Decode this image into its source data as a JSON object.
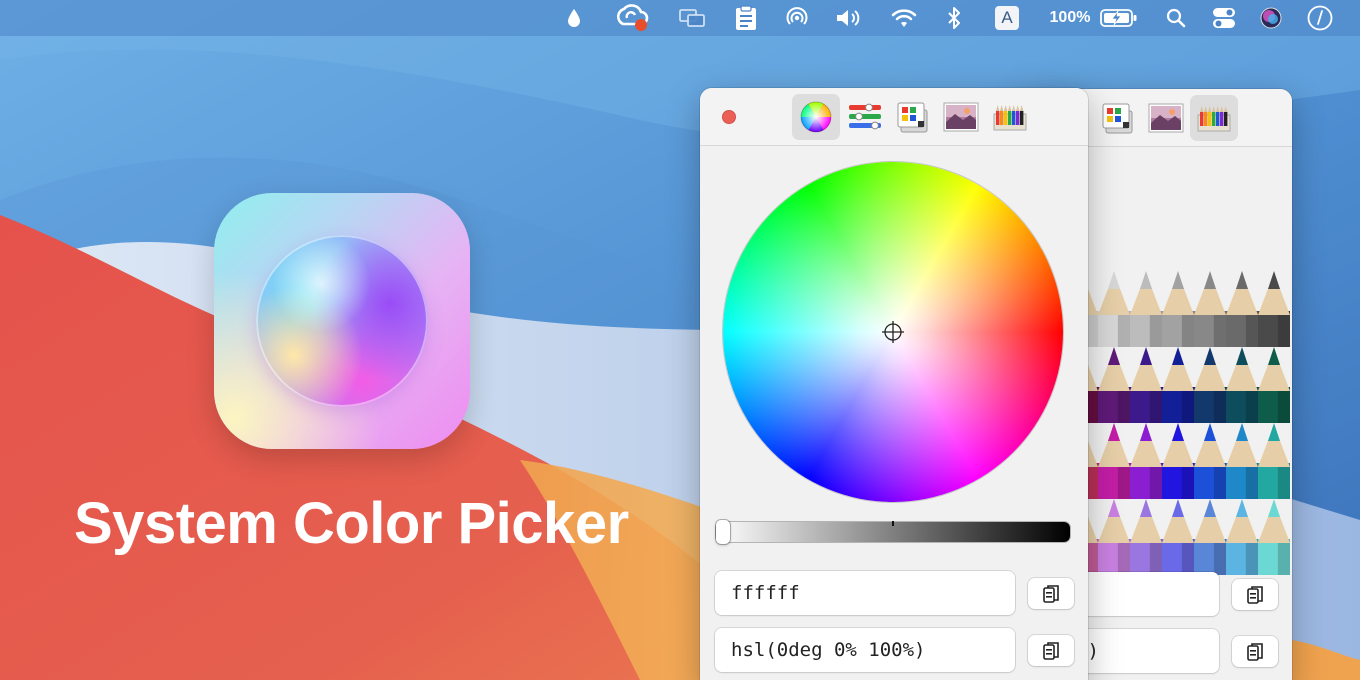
{
  "app": {
    "title": "System Color Picker"
  },
  "menubar": {
    "battery_percent": "100%",
    "input_source": "A",
    "items": [
      "drop-icon",
      "creative-cloud-icon",
      "screen-mirror-icon",
      "clipboard-icon",
      "airdrop-icon",
      "volume-icon",
      "wifi-icon",
      "bluetooth-icon",
      "input-source-icon",
      "battery-icon",
      "spotlight-icon",
      "control-center-icon",
      "siri-icon",
      "clock-icon"
    ],
    "badge_color": "#e84e2c"
  },
  "front_panel": {
    "tabs": [
      "color-wheel-icon",
      "color-sliders-icon",
      "color-palettes-icon",
      "image-palettes-icon",
      "pencils-icon"
    ],
    "active_tab": "color-wheel-icon",
    "hex_value": "ffffff",
    "hsl_value": "hsl(0deg 0% 100%)",
    "brightness_percent": 100
  },
  "back_panel": {
    "tabs": [
      "color-palettes-icon",
      "image-palettes-icon",
      "pencils-icon"
    ],
    "active_tab": "pencils-icon",
    "hex_value": "",
    "hsl_value_visible": "100%)"
  },
  "colors": {
    "close": "#ec5f57",
    "wallpaper_blue": "#3f7fc6",
    "wallpaper_red": "#e2574c",
    "wallpaper_orange": "#eea14e",
    "pencils": [
      [
        "#f7f7f7",
        "#d7d7d7",
        "#bcbcbc",
        "#a2a2a2",
        "#888888",
        "#6a6a6a",
        "#4a4a4a"
      ],
      [
        "#7a1250",
        "#5e1a78",
        "#3c1a8c",
        "#121f96",
        "#12386c",
        "#0e4d5c",
        "#0e5c4a"
      ],
      [
        "#e23a6c",
        "#c21ea6",
        "#8a1ed0",
        "#2016e0",
        "#1c50d8",
        "#1e88c8",
        "#22a8a0"
      ],
      [
        "#e870b8",
        "#c880e0",
        "#9a76e0",
        "#6a6ae8",
        "#5a86d8",
        "#5cb4e2",
        "#6cd8d4"
      ]
    ]
  }
}
